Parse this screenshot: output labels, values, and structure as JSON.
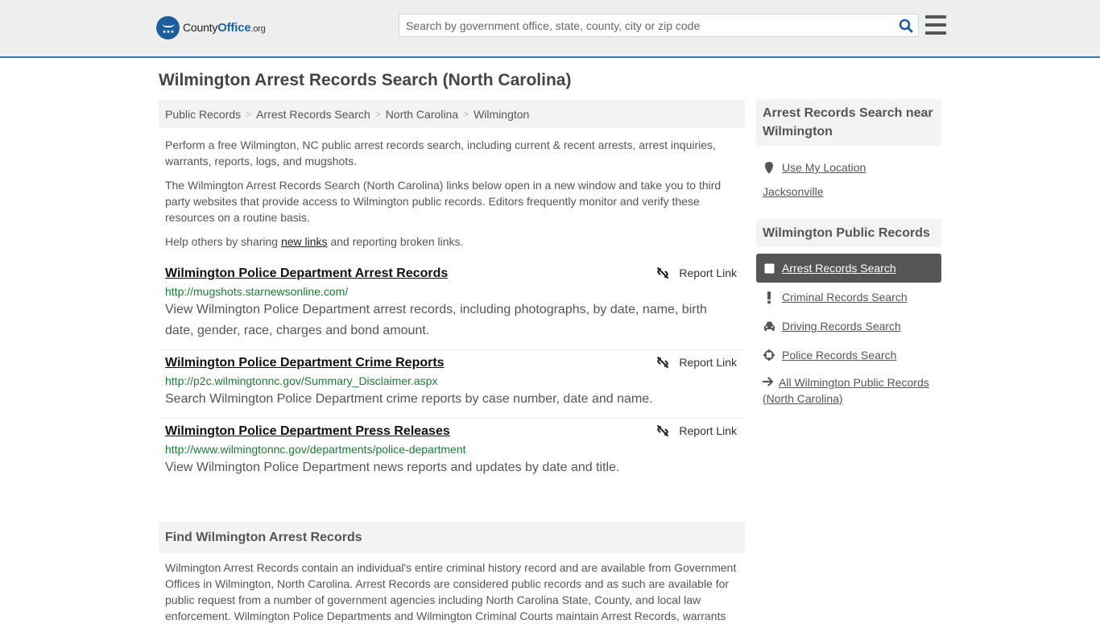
{
  "header": {
    "logo": {
      "county": "County",
      "office": "Office",
      "org": ".org"
    },
    "search": {
      "placeholder": "Search by government office, state, county, city or zip code",
      "value": ""
    },
    "icons": {
      "search": "search-icon",
      "menu": "hamburger-menu-icon"
    },
    "accent_color": "#337ab7"
  },
  "page_title": "Wilmington Arrest Records Search (North Carolina)",
  "breadcrumb": [
    {
      "label": "Public Records"
    },
    {
      "label": "Arrest Records Search"
    },
    {
      "label": "North Carolina"
    },
    {
      "label": "Wilmington"
    }
  ],
  "intro": {
    "p1": "Perform a free Wilmington, NC public arrest records search, including current & recent arrests, arrest inquiries, warrants, reports, logs, and mugshots.",
    "p2": "The Wilmington Arrest Records Search (North Carolina) links below open in a new window and take you to third party websites that provide access to Wilmington public records. Editors frequently monitor and verify these resources on a routine basis.",
    "p3_before": "Help others by sharing ",
    "p3_link": "new links",
    "p3_after": " and reporting broken links."
  },
  "links": [
    {
      "title": "Wilmington Police Department Arrest Records",
      "url": "http://mugshots.starnewsonline.com/",
      "description": "View Wilmington Police Department arrest records, including photographs, by date, name, birth date, gender, race, charges and bond amount.",
      "report_label": "Report Link"
    },
    {
      "title": "Wilmington Police Department Crime Reports",
      "url": "http://p2c.wilmingtonnc.gov/Summary_Disclaimer.aspx",
      "description": "Search Wilmington Police Department crime reports by case number, date and name.",
      "report_label": "Report Link"
    },
    {
      "title": "Wilmington Police Department Press Releases",
      "url": "http://www.wilmingtonnc.gov/departments/police-department",
      "description": "View Wilmington Police Department news reports and updates by date and title.",
      "report_label": "Report Link"
    }
  ],
  "find_section": {
    "heading": "Find Wilmington Arrest Records",
    "text": "Wilmington Arrest Records contain an individual's entire criminal history record and are available from Government Offices in Wilmington, North Carolina. Arrest Records are considered public records and as such are available for public request from a number of government agencies including North Carolina State, County, and local law enforcement. Wilmington Police Departments and Wilmington Criminal Courts maintain Arrest Records, warrants"
  },
  "sidebar": {
    "near_heading": "Arrest Records Search near Wilmington",
    "use_location": "Use My Location",
    "nearby": [
      "Jacksonville"
    ],
    "public_heading": "Wilmington Public Records",
    "items": [
      {
        "label": "Arrest Records Search",
        "icon": "square-icon",
        "active": true
      },
      {
        "label": "Criminal Records Search",
        "icon": "exclamation-icon",
        "active": false
      },
      {
        "label": "Driving Records Search",
        "icon": "car-icon",
        "active": false
      },
      {
        "label": "Police Records Search",
        "icon": "crosshairs-icon",
        "active": false
      }
    ],
    "all_records": "All Wilmington Public Records (North Carolina)"
  }
}
